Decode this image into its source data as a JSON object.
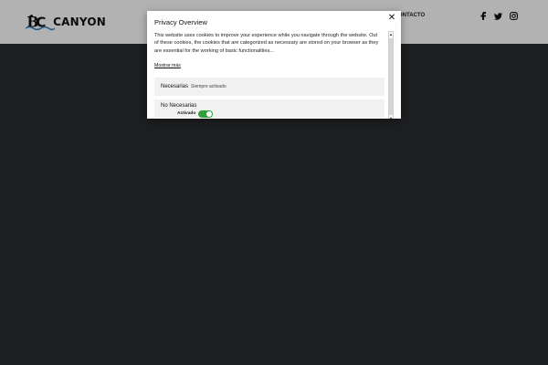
{
  "header": {
    "logo_text": "CANYON",
    "nav_item": "ONTACTO",
    "social": [
      "facebook-icon",
      "twitter-icon",
      "instagram-icon"
    ]
  },
  "modal": {
    "title": "Privacy Overview",
    "description": "This website uses cookies to improve your experience while you navigate through the website. Out of these cookies, the cookies that are categorized as necessary are stored on your browser as they are essential for the working of basic functionalities...",
    "more_link": "Mostrar más",
    "categories": [
      {
        "name": "Necesarias",
        "status": "Siempre activado"
      },
      {
        "name": "No Necesarias",
        "toggle_label": "Activado",
        "toggle_on": true
      }
    ],
    "close_symbol": "✕"
  },
  "colors": {
    "background": "#2a2b2f",
    "toggle_on": "#2e9f3a"
  }
}
